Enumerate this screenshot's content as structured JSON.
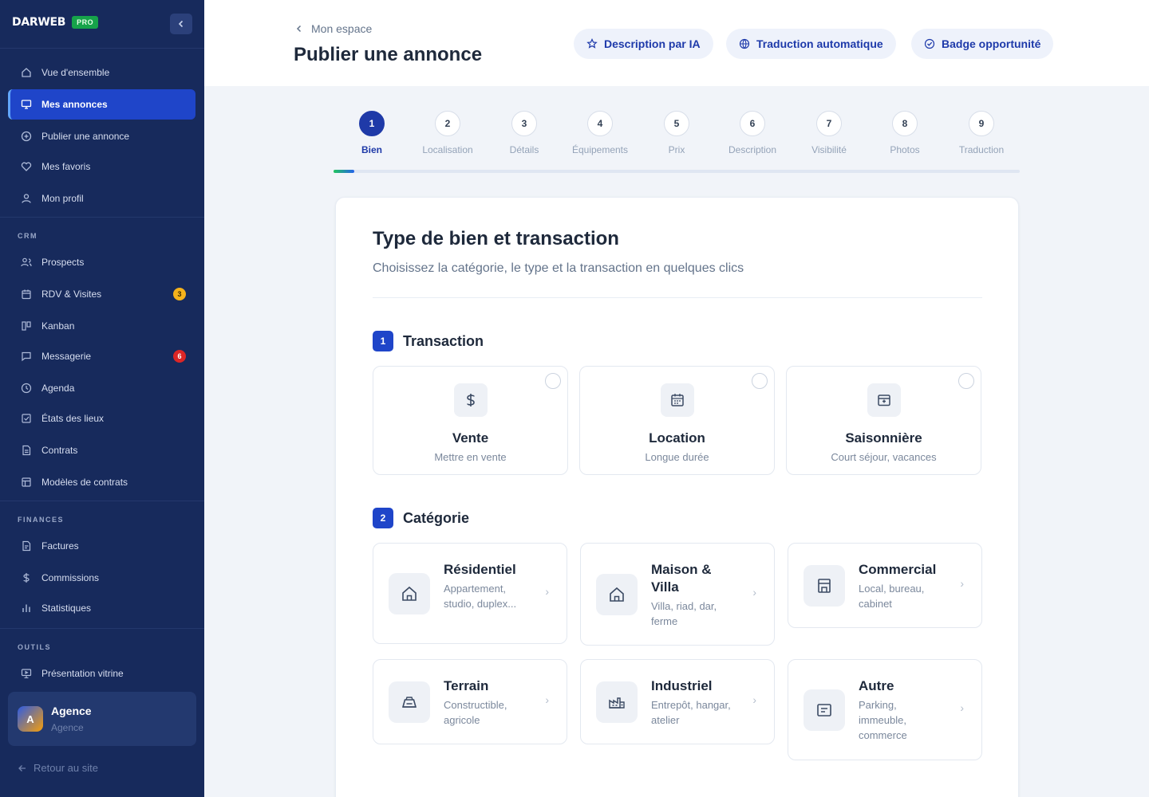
{
  "sidebar": {
    "brand": "DARWEB",
    "pro_badge": "PRO",
    "items_main": [
      {
        "label": "Vue d'ensemble",
        "icon": "home-icon"
      },
      {
        "label": "Mes annonces",
        "icon": "monitor-icon",
        "active": true
      },
      {
        "label": "Publier une annonce",
        "icon": "plus-circle-icon"
      },
      {
        "label": "Mes favoris",
        "icon": "heart-icon"
      },
      {
        "label": "Mon profil",
        "icon": "user-icon"
      }
    ],
    "crm_label": "CRM",
    "items_crm": [
      {
        "label": "Prospects",
        "icon": "users-icon"
      },
      {
        "label": "RDV & Visites",
        "icon": "calendar-icon",
        "badge": "3"
      },
      {
        "label": "Kanban",
        "icon": "kanban-icon"
      },
      {
        "label": "Messagerie",
        "icon": "message-icon",
        "badge": "6"
      },
      {
        "label": "Agenda",
        "icon": "clock-icon"
      },
      {
        "label": "États des lieux",
        "icon": "checklist-icon"
      },
      {
        "label": "Contrats",
        "icon": "file-icon"
      },
      {
        "label": "Modèles de contrats",
        "icon": "template-icon"
      }
    ],
    "finances_label": "FINANCES",
    "items_finances": [
      {
        "label": "Factures",
        "icon": "invoice-icon"
      },
      {
        "label": "Commissions",
        "icon": "dollar-icon"
      },
      {
        "label": "Statistiques",
        "icon": "bar-chart-icon"
      }
    ],
    "outils_label": "OUTILS",
    "items_outils": [
      {
        "label": "Présentation vitrine",
        "icon": "presentation-icon"
      }
    ],
    "agency": {
      "initial": "A",
      "name": "Agence",
      "sub": "Agence"
    },
    "back_label": "Retour au site",
    "colors": {
      "background": "#172a5c",
      "active": "#1f45c9"
    }
  },
  "header": {
    "breadcrumb": "Mon espace",
    "title": "Publier une annonce",
    "actions": [
      {
        "label": "Description par IA",
        "icon": "star-icon"
      },
      {
        "label": "Traduction automatique",
        "icon": "globe-icon"
      },
      {
        "label": "Badge opportunité",
        "icon": "badge-check-icon"
      }
    ]
  },
  "stepper": {
    "steps": [
      {
        "num": "1",
        "label": "Bien"
      },
      {
        "num": "2",
        "label": "Localisation"
      },
      {
        "num": "3",
        "label": "Détails"
      },
      {
        "num": "4",
        "label": "Équipements"
      },
      {
        "num": "5",
        "label": "Prix"
      },
      {
        "num": "6",
        "label": "Description"
      },
      {
        "num": "7",
        "label": "Visibilité"
      },
      {
        "num": "8",
        "label": "Photos"
      },
      {
        "num": "9",
        "label": "Traduction"
      }
    ],
    "active_step": 1,
    "progress_fraction": 0.03
  },
  "form": {
    "title": "Type de bien et transaction",
    "subtitle": "Choisissez la catégorie, le type et la transaction en quelques clics",
    "transaction": {
      "num": "1",
      "title": "Transaction",
      "options": [
        {
          "title": "Vente",
          "sub": "Mettre en vente",
          "icon": "dollar-icon"
        },
        {
          "title": "Location",
          "sub": "Longue durée",
          "icon": "calendar-icon"
        },
        {
          "title": "Saisonnière",
          "sub": "Court séjour, vacances",
          "icon": "archive-icon"
        }
      ]
    },
    "category": {
      "num": "2",
      "title": "Catégorie",
      "options": [
        {
          "title": "Résidentiel",
          "desc": "Appartement, studio, duplex...",
          "icon": "house-icon"
        },
        {
          "title": "Maison & Villa",
          "desc": "Villa, riad, dar, ferme",
          "icon": "house-icon"
        },
        {
          "title": "Commercial",
          "desc": "Local, bureau, cabinet",
          "icon": "store-icon"
        },
        {
          "title": "Terrain",
          "desc": "Constructible, agricole",
          "icon": "land-icon"
        },
        {
          "title": "Industriel",
          "desc": "Entrepôt, hangar, atelier",
          "icon": "factory-icon"
        },
        {
          "title": "Autre",
          "desc": "Parking, immeuble, commerce",
          "icon": "box-icon"
        }
      ]
    }
  }
}
